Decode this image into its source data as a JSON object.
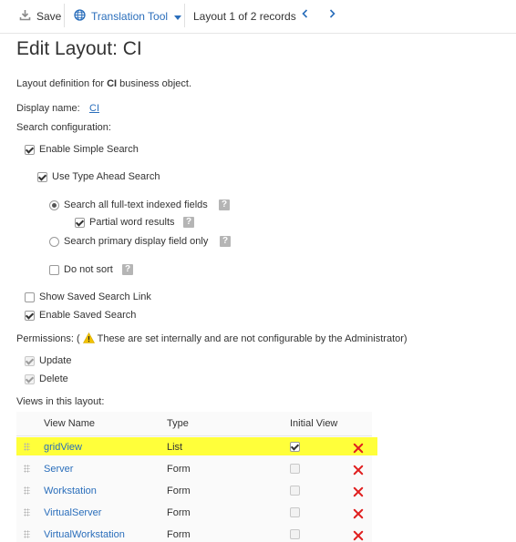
{
  "toolbar": {
    "save_label": "Save",
    "translation_label": "Translation Tool",
    "record_info": "Layout 1 of 2 records"
  },
  "page": {
    "title": "Edit Layout: CI",
    "desc_prefix": "Layout definition for ",
    "desc_bold": "CI",
    "desc_suffix": " business object.",
    "display_name_label": "Display name:",
    "display_name_value": "CI",
    "search_config_label": "Search configuration:"
  },
  "search": {
    "enable_simple": "Enable Simple Search",
    "use_type_ahead": "Use Type Ahead Search",
    "search_all_fulltext": "Search all full-text indexed fields",
    "partial_word": "Partial word results",
    "search_primary": "Search primary display field only",
    "do_not_sort": "Do not sort",
    "show_saved_link": "Show Saved Search Link",
    "enable_saved": "Enable Saved Search"
  },
  "permissions": {
    "label_prefix": "Permissions: (",
    "label_text": " These are set internally and are not configurable by the Administrator)",
    "update": "Update",
    "delete": "Delete"
  },
  "views": {
    "label": "Views in this layout:",
    "col_name": "View Name",
    "col_type": "Type",
    "col_initial": "Initial View",
    "rows": [
      {
        "name": "gridView",
        "type": "List",
        "initial": true
      },
      {
        "name": "Server",
        "type": "Form",
        "initial": false
      },
      {
        "name": "Workstation",
        "type": "Form",
        "initial": false
      },
      {
        "name": "VirtualServer",
        "type": "Form",
        "initial": false
      },
      {
        "name": "VirtualWorkstation",
        "type": "Form",
        "initial": false
      }
    ]
  },
  "colors": {
    "accent": "#2a6ebb",
    "highlight": "#ffff3a",
    "delete": "#e02020"
  }
}
